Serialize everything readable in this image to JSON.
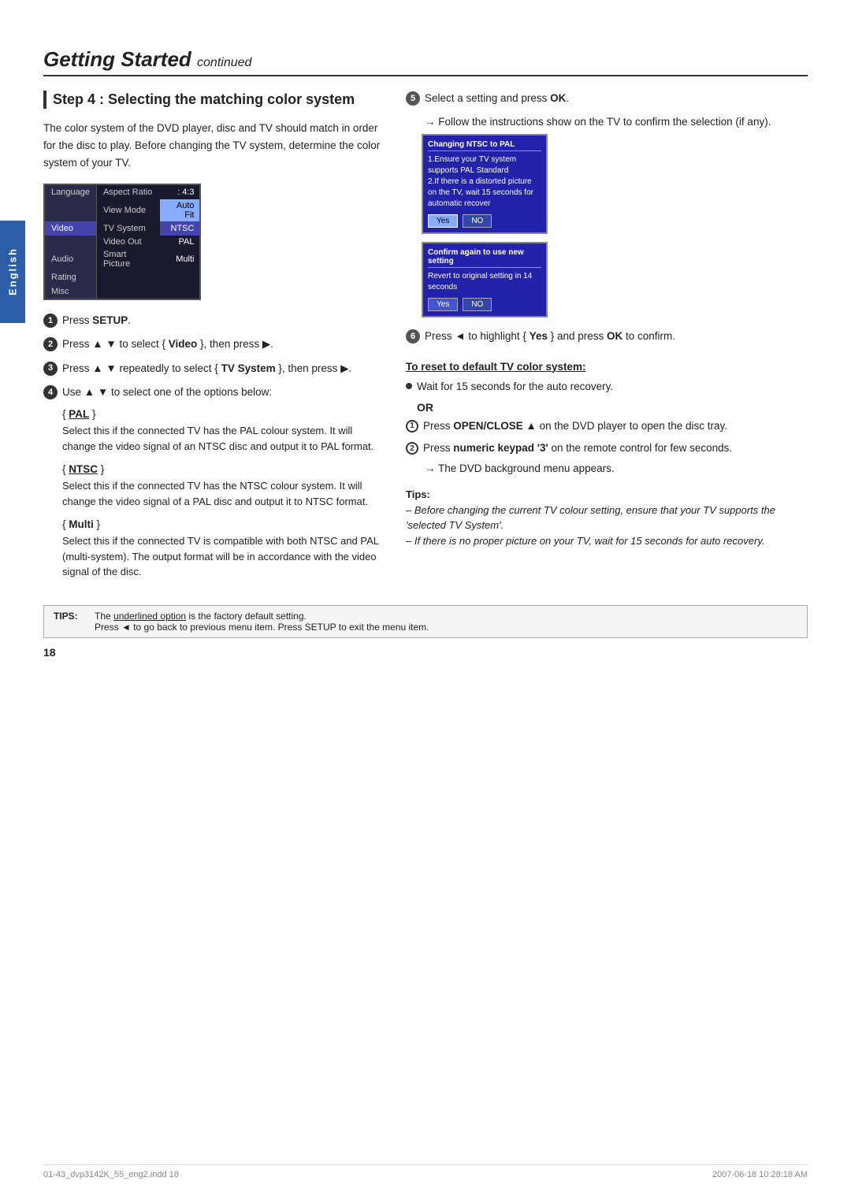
{
  "header": {
    "title": "Getting Started",
    "continued": "continued"
  },
  "english_tab": "English",
  "step": {
    "number": "Step 4 :",
    "title": "Selecting the matching color system"
  },
  "intro_text": "The color system of the DVD player, disc and TV should match in order for the disc to play. Before changing the TV system, determine the color system of your TV.",
  "menu": {
    "items": [
      {
        "left": "Language",
        "right_label": "Aspect Ratio",
        "right_value": ": 4:3"
      },
      {
        "left": "",
        "right_label": "View Mode",
        "right_value": "Auto Fit",
        "highlight": true
      },
      {
        "left": "Video",
        "right_label": "TV System",
        "right_value": "NTSC",
        "selected": true
      },
      {
        "left": "",
        "right_label": "Video Out",
        "right_value": "PAL"
      },
      {
        "left": "Audio",
        "right_label": "Smart Picture",
        "right_value": "Multi"
      },
      {
        "left": "Rating",
        "right_label": "",
        "right_value": ""
      },
      {
        "left": "Misc",
        "right_label": "",
        "right_value": ""
      }
    ]
  },
  "left_steps": [
    {
      "num": "1",
      "text": "Press SETUP."
    },
    {
      "num": "2",
      "text": "Press ▲ ▼ to select { Video }, then press ▶."
    },
    {
      "num": "3",
      "text": "Press ▲ ▼ repeatedly to select { TV System }, then press ▶."
    },
    {
      "num": "4",
      "text": "Use ▲ ▼ to select one of the options below:"
    }
  ],
  "options": [
    {
      "label": "{ PAL }",
      "label_type": "pal",
      "desc": "Select this if the connected TV has the PAL colour system. It will change the video signal of an NTSC disc and output it to PAL format."
    },
    {
      "label": "{ NTSC }",
      "label_type": "ntsc",
      "desc": "Select this if the connected TV has the NTSC colour system. It will change the video signal of a PAL disc and output it to NTSC format."
    },
    {
      "label": "{ Multi }",
      "label_type": "multi",
      "desc": "Select this if the connected TV is compatible with both NTSC and PAL (multi-system). The output format will be in accordance with the video signal of the disc."
    }
  ],
  "right_steps": [
    {
      "num": "5",
      "text": "Select a setting and press OK."
    },
    {
      "arrow": "→ Follow the instructions show on the TV to confirm the selection (if any)."
    }
  ],
  "dialog1": {
    "title": "Changing NTSC to PAL",
    "lines": [
      "1.Ensure your TV system supports PAL Standard",
      "2.If there is a distorted picture on the TV, wait 15 seconds for automatic recover"
    ],
    "btn_yes": "Yes",
    "btn_no": "NO"
  },
  "dialog2": {
    "title": "Confirm again to use new setting",
    "subtitle": "Revert to original setting in 14 seconds",
    "btn_yes": "Yes",
    "btn_no": "NO"
  },
  "step6": {
    "text": "Press ◄ to highlight { Yes } and press OK to confirm."
  },
  "reset_section": {
    "title": "To reset to default TV color system:",
    "items": [
      {
        "bullet": "dot",
        "text": "Wait for 15 seconds for the auto recovery."
      },
      {
        "or_text": "OR"
      },
      {
        "num": "1",
        "text": "Press OPEN/CLOSE ▲ on the DVD player to open the disc tray."
      },
      {
        "num": "2",
        "text": "Press numeric keypad '3' on the remote control for few seconds."
      },
      {
        "arrow": "→ The DVD background menu appears."
      }
    ]
  },
  "tips_italic": {
    "title": "Tips:",
    "lines": [
      "– Before changing the current TV colour setting, ensure that your TV supports the 'selected TV System'.",
      "– If there is no proper picture on your TV, wait for 15 seconds for auto recovery."
    ]
  },
  "bottom_bar": {
    "tips_label": "TIPS:",
    "text1": "The underlined option is the factory default setting.",
    "text2": "Press ◄ to go back to previous menu item. Press SETUP to exit the menu item."
  },
  "page_number": "18",
  "footer": {
    "left": "01-43_dvp3142K_55_eng2.indd  18",
    "right": "2007-06-18  10:28:18 AM"
  }
}
